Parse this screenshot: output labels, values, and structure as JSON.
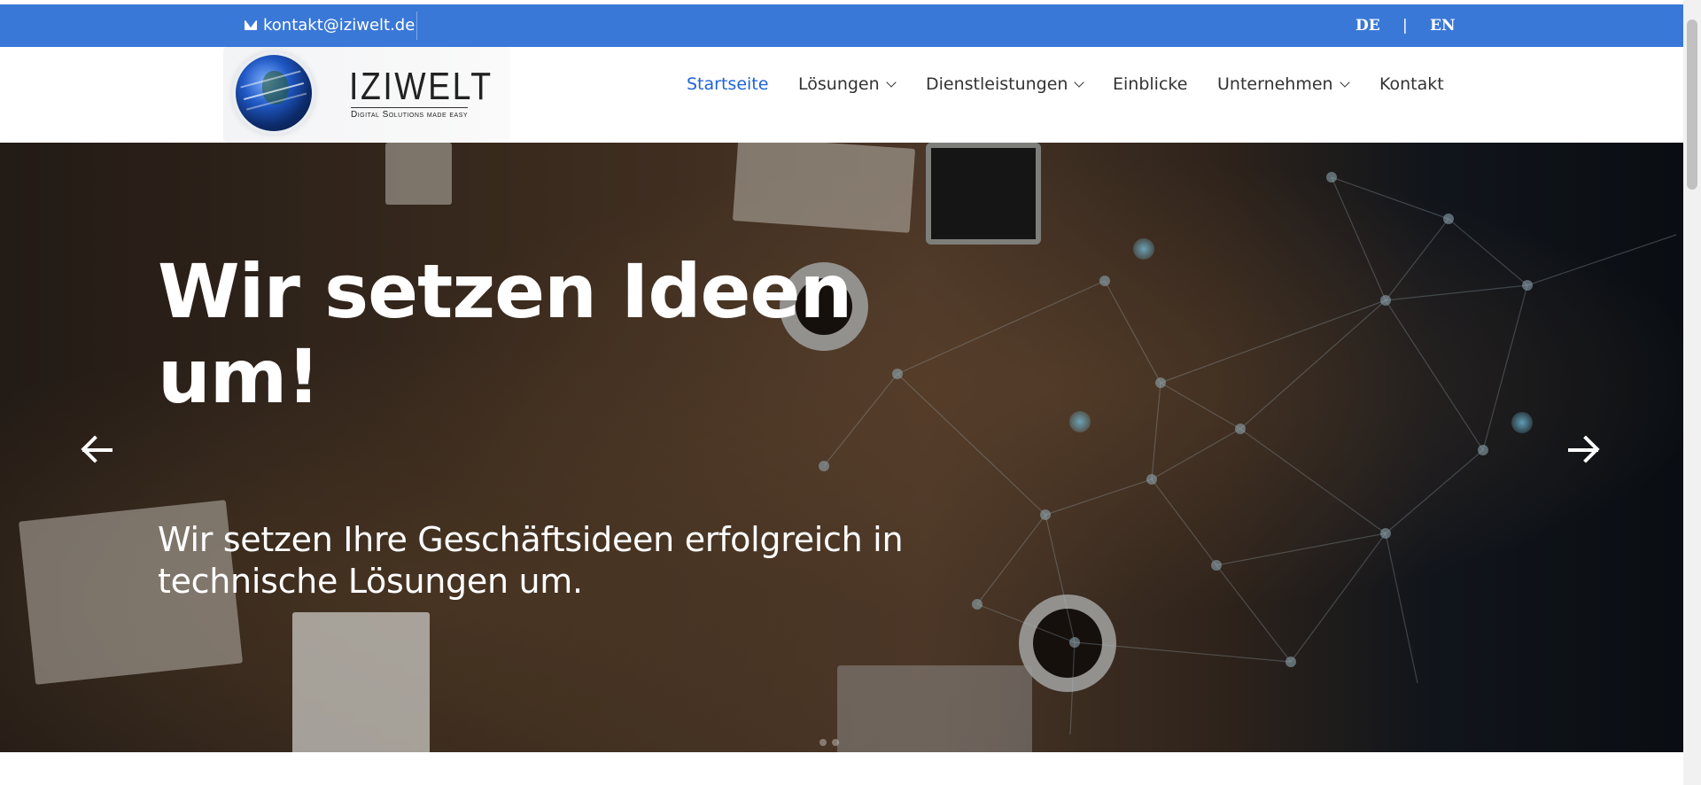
{
  "topbar": {
    "email": "kontakt@iziwelt.de",
    "email_icon": "envelope-icon",
    "lang_de": "DE",
    "lang_sep": "|",
    "lang_en": "EN",
    "bg_color": "#3a78d8"
  },
  "logo": {
    "wordmark": "IZIWELT",
    "tagline": "Digital Solutions made easy"
  },
  "nav": {
    "items": [
      {
        "label": "Startseite",
        "active": true
      },
      {
        "label": "Lösungen",
        "dropdown": true
      },
      {
        "label": "Dienstleistungen",
        "dropdown": true
      },
      {
        "label": "Einblicke"
      },
      {
        "label": "Unternehmen",
        "dropdown": true
      },
      {
        "label": "Kontakt"
      }
    ],
    "active_color": "#1f63d6"
  },
  "hero": {
    "title": "Wir setzen Ideen um!",
    "subtitle": "Wir setzen Ihre Geschäftsideen erfolgreich in technische Lösungen um.",
    "prev_icon": "arrow-left-icon",
    "next_icon": "arrow-right-icon"
  }
}
